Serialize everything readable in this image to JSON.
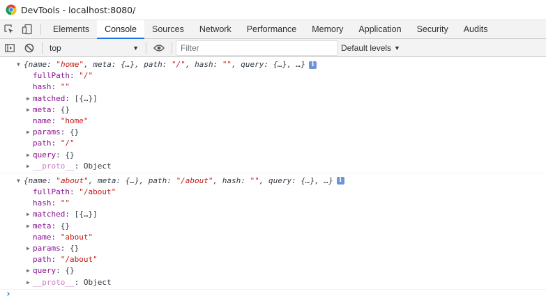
{
  "window": {
    "title": "DevTools - localhost:8080/",
    "app_icon": "chrome-logo-icon"
  },
  "tabs": [
    {
      "label": "Elements",
      "active": false
    },
    {
      "label": "Console",
      "active": true
    },
    {
      "label": "Sources",
      "active": false
    },
    {
      "label": "Network",
      "active": false
    },
    {
      "label": "Performance",
      "active": false
    },
    {
      "label": "Memory",
      "active": false
    },
    {
      "label": "Application",
      "active": false
    },
    {
      "label": "Security",
      "active": false
    },
    {
      "label": "Audits",
      "active": false
    }
  ],
  "toolbar": {
    "context": "top",
    "filter_placeholder": "Filter",
    "levels_label": "Default levels"
  },
  "colors": {
    "accent": "#1a73e8",
    "key": "#881391",
    "string": "#c41a16"
  },
  "messages": [
    {
      "summary": [
        [
          "p",
          "{name: "
        ],
        [
          "s",
          "\"home\""
        ],
        [
          "p",
          ", meta: {…}, path: "
        ],
        [
          "s",
          "\"/\""
        ],
        [
          "p",
          ", hash: "
        ],
        [
          "s",
          "\"\""
        ],
        [
          "p",
          ", query: {…}, …}"
        ]
      ],
      "props": [
        {
          "key": "fullPath",
          "value": "\"/\"",
          "type": "s",
          "expandable": false,
          "dim": false
        },
        {
          "key": "hash",
          "value": "\"\"",
          "type": "s",
          "expandable": false,
          "dim": false
        },
        {
          "key": "matched",
          "value": "[{…}]",
          "type": "p",
          "expandable": true,
          "dim": false
        },
        {
          "key": "meta",
          "value": "{}",
          "type": "p",
          "expandable": true,
          "dim": false
        },
        {
          "key": "name",
          "value": "\"home\"",
          "type": "s",
          "expandable": false,
          "dim": false
        },
        {
          "key": "params",
          "value": "{}",
          "type": "p",
          "expandable": true,
          "dim": false
        },
        {
          "key": "path",
          "value": "\"/\"",
          "type": "s",
          "expandable": false,
          "dim": false
        },
        {
          "key": "query",
          "value": "{}",
          "type": "p",
          "expandable": true,
          "dim": false
        },
        {
          "key": "__proto__",
          "value": "Object",
          "type": "p",
          "expandable": true,
          "dim": true
        }
      ]
    },
    {
      "summary": [
        [
          "p",
          "{name: "
        ],
        [
          "s",
          "\"about\""
        ],
        [
          "p",
          ", meta: {…}, path: "
        ],
        [
          "s",
          "\"/about\""
        ],
        [
          "p",
          ", hash: "
        ],
        [
          "s",
          "\"\""
        ],
        [
          "p",
          ", query: {…}, …}"
        ]
      ],
      "props": [
        {
          "key": "fullPath",
          "value": "\"/about\"",
          "type": "s",
          "expandable": false,
          "dim": false
        },
        {
          "key": "hash",
          "value": "\"\"",
          "type": "s",
          "expandable": false,
          "dim": false
        },
        {
          "key": "matched",
          "value": "[{…}]",
          "type": "p",
          "expandable": true,
          "dim": false
        },
        {
          "key": "meta",
          "value": "{}",
          "type": "p",
          "expandable": true,
          "dim": false
        },
        {
          "key": "name",
          "value": "\"about\"",
          "type": "s",
          "expandable": false,
          "dim": false
        },
        {
          "key": "params",
          "value": "{}",
          "type": "p",
          "expandable": true,
          "dim": false
        },
        {
          "key": "path",
          "value": "\"/about\"",
          "type": "s",
          "expandable": false,
          "dim": false
        },
        {
          "key": "query",
          "value": "{}",
          "type": "p",
          "expandable": true,
          "dim": false
        },
        {
          "key": "__proto__",
          "value": "Object",
          "type": "p",
          "expandable": true,
          "dim": true
        }
      ]
    }
  ]
}
